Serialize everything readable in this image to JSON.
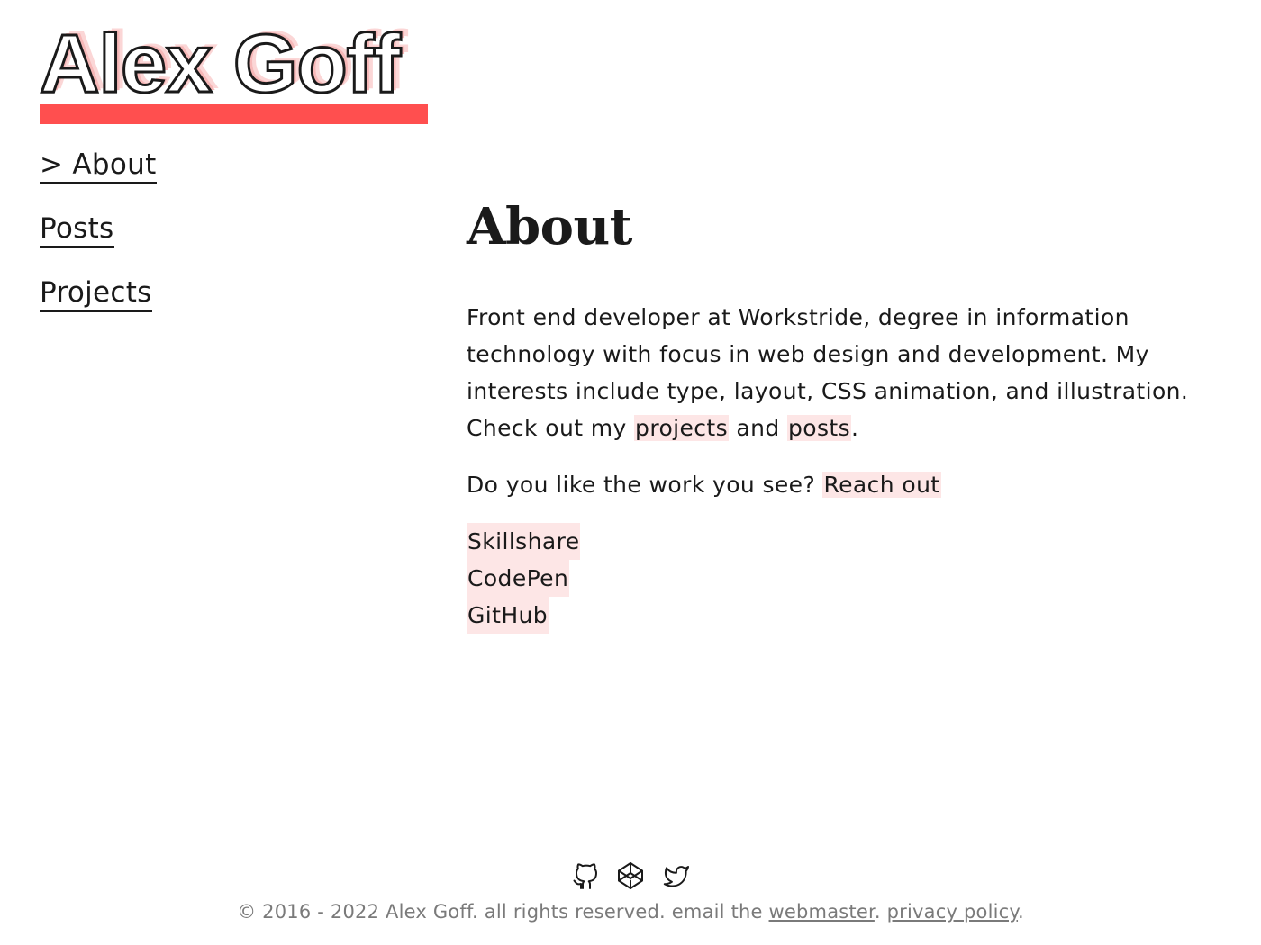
{
  "header": {
    "site_title": "Alex Goff",
    "accent_color": "#ff4f4f"
  },
  "nav": {
    "items": [
      {
        "label": "> About",
        "active": true
      },
      {
        "label": "Posts",
        "active": false
      },
      {
        "label": "Projects",
        "active": false
      }
    ]
  },
  "main": {
    "heading": "About",
    "intro": {
      "text_1": "Front end developer at Workstride, degree in information technology with focus in web design and development. My interests include type, layout, CSS animation, and illustration. Check out my ",
      "link_projects": "projects",
      "text_2": " and ",
      "link_posts": "posts",
      "text_3": "."
    },
    "contact": {
      "text": "Do you like the work you see? ",
      "link": "Reach out"
    },
    "profile_links": [
      "Skillshare",
      "CodePen",
      "GitHub"
    ],
    "highlight_color": "#fde6e6"
  },
  "footer": {
    "icons": [
      "github-icon",
      "codepen-icon",
      "twitter-icon"
    ],
    "copyright": "© 2016 - 2022 Alex Goff. all rights reserved. email the ",
    "webmaster_link": "webmaster",
    "separator": ". ",
    "privacy_link": "privacy policy",
    "end": "."
  }
}
